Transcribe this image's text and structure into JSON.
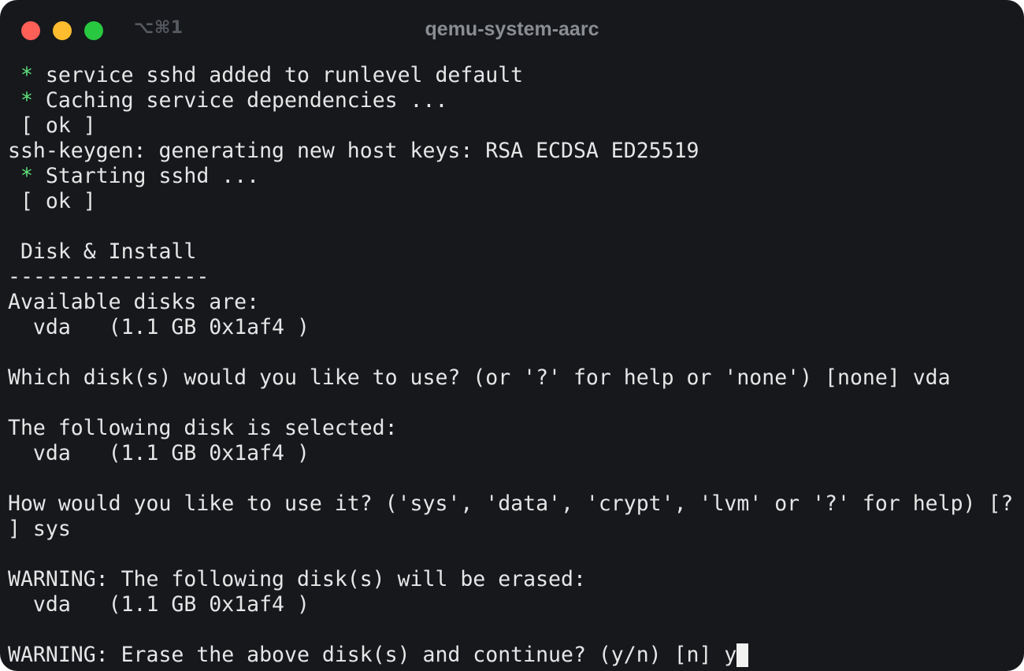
{
  "window": {
    "title": "qemu-system-aarc",
    "shortcut": "⌥⌘1",
    "controls": {
      "close": "close-button",
      "minimize": "minimize-button",
      "zoom": "zoom-button"
    }
  },
  "colors": {
    "background": "#16181c",
    "text": "#e6e6e6",
    "star": "#5ee07a",
    "close": "#fe5f57",
    "minimize": "#febc2e",
    "zoom": "#28c840"
  },
  "terminal": {
    "lines": [
      {
        "star": " *",
        "text": " service sshd added to runlevel default"
      },
      {
        "star": " *",
        "text": " Caching service dependencies ..."
      },
      {
        "text": " [ ok ]"
      },
      {
        "text": "ssh-keygen: generating new host keys: RSA ECDSA ED25519"
      },
      {
        "star": " *",
        "text": " Starting sshd ..."
      },
      {
        "text": " [ ok ]"
      },
      {
        "text": ""
      },
      {
        "text": " Disk & Install"
      },
      {
        "text": "----------------"
      },
      {
        "text": "Available disks are:"
      },
      {
        "text": "  vda   (1.1 GB 0x1af4 )"
      },
      {
        "text": ""
      },
      {
        "text": "Which disk(s) would you like to use? (or '?' for help or 'none') [none] vda"
      },
      {
        "text": ""
      },
      {
        "text": "The following disk is selected:"
      },
      {
        "text": "  vda   (1.1 GB 0x1af4 )"
      },
      {
        "text": ""
      },
      {
        "text": "How would you like to use it? ('sys', 'data', 'crypt', 'lvm' or '?' for help) [?"
      },
      {
        "text": "] sys"
      },
      {
        "text": ""
      },
      {
        "text": "WARNING: The following disk(s) will be erased:"
      },
      {
        "text": "  vda   (1.1 GB 0x1af4 )"
      },
      {
        "text": ""
      },
      {
        "text": "WARNING: Erase the above disk(s) and continue? (y/n) [n] y",
        "cursor": true
      }
    ]
  }
}
